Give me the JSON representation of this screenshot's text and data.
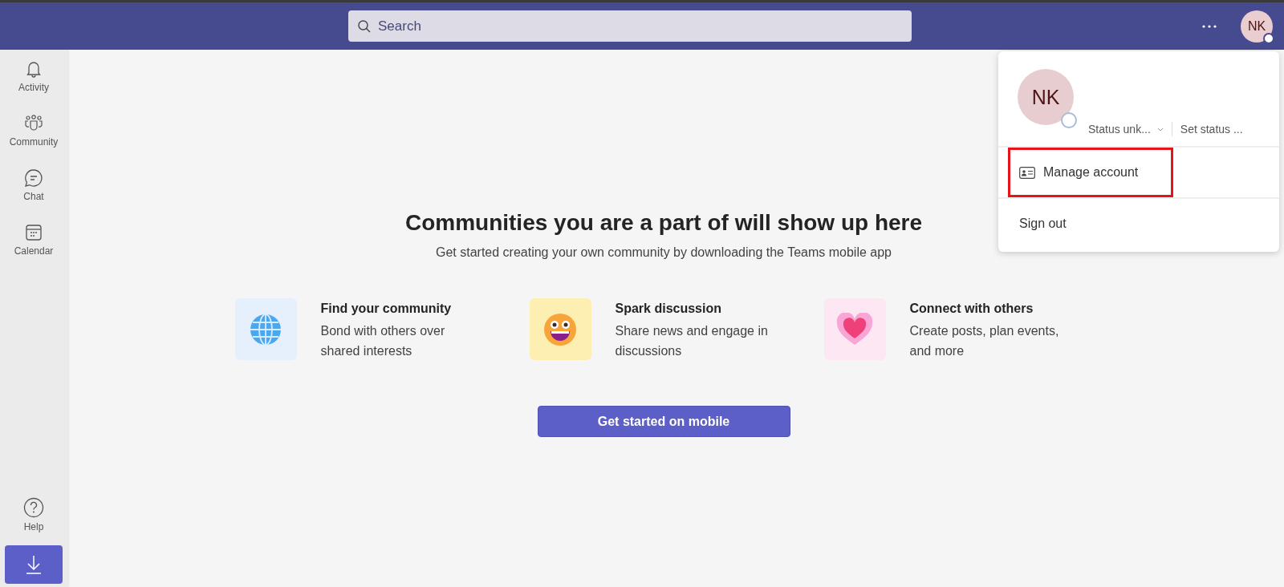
{
  "search": {
    "placeholder": "Search"
  },
  "avatar": {
    "initials": "NK"
  },
  "sidebar": {
    "items": [
      {
        "kind": "bell",
        "label": "Activity"
      },
      {
        "kind": "people",
        "label": "Community"
      },
      {
        "kind": "chat",
        "label": "Chat"
      },
      {
        "kind": "calendar",
        "label": "Calendar"
      }
    ],
    "bottom": [
      {
        "kind": "help",
        "label": "Help"
      }
    ]
  },
  "main": {
    "heading": "Communities you are a part of will show up here",
    "subheading": "Get started creating your own community by downloading the Teams mobile app",
    "features": [
      {
        "kind": "globe",
        "color": "#e6f0fc",
        "title": "Find your community",
        "text": "Bond with others over shared interests"
      },
      {
        "kind": "smiley",
        "color": "#fdefb2",
        "title": "Spark discussion",
        "text": "Share news and engage in discussions"
      },
      {
        "kind": "heart",
        "color": "#fde7f3",
        "title": "Connect with others",
        "text": "Create posts, plan events, and more"
      }
    ],
    "button": "Get started on mobile"
  },
  "account_menu": {
    "initials": "NK",
    "status": "Status unk...",
    "set_status": "Set status ...",
    "items": [
      {
        "kind": "card",
        "label": "Manage account",
        "highlighted": true
      },
      {
        "kind": "plain",
        "label": "Sign out",
        "highlighted": false
      }
    ]
  }
}
